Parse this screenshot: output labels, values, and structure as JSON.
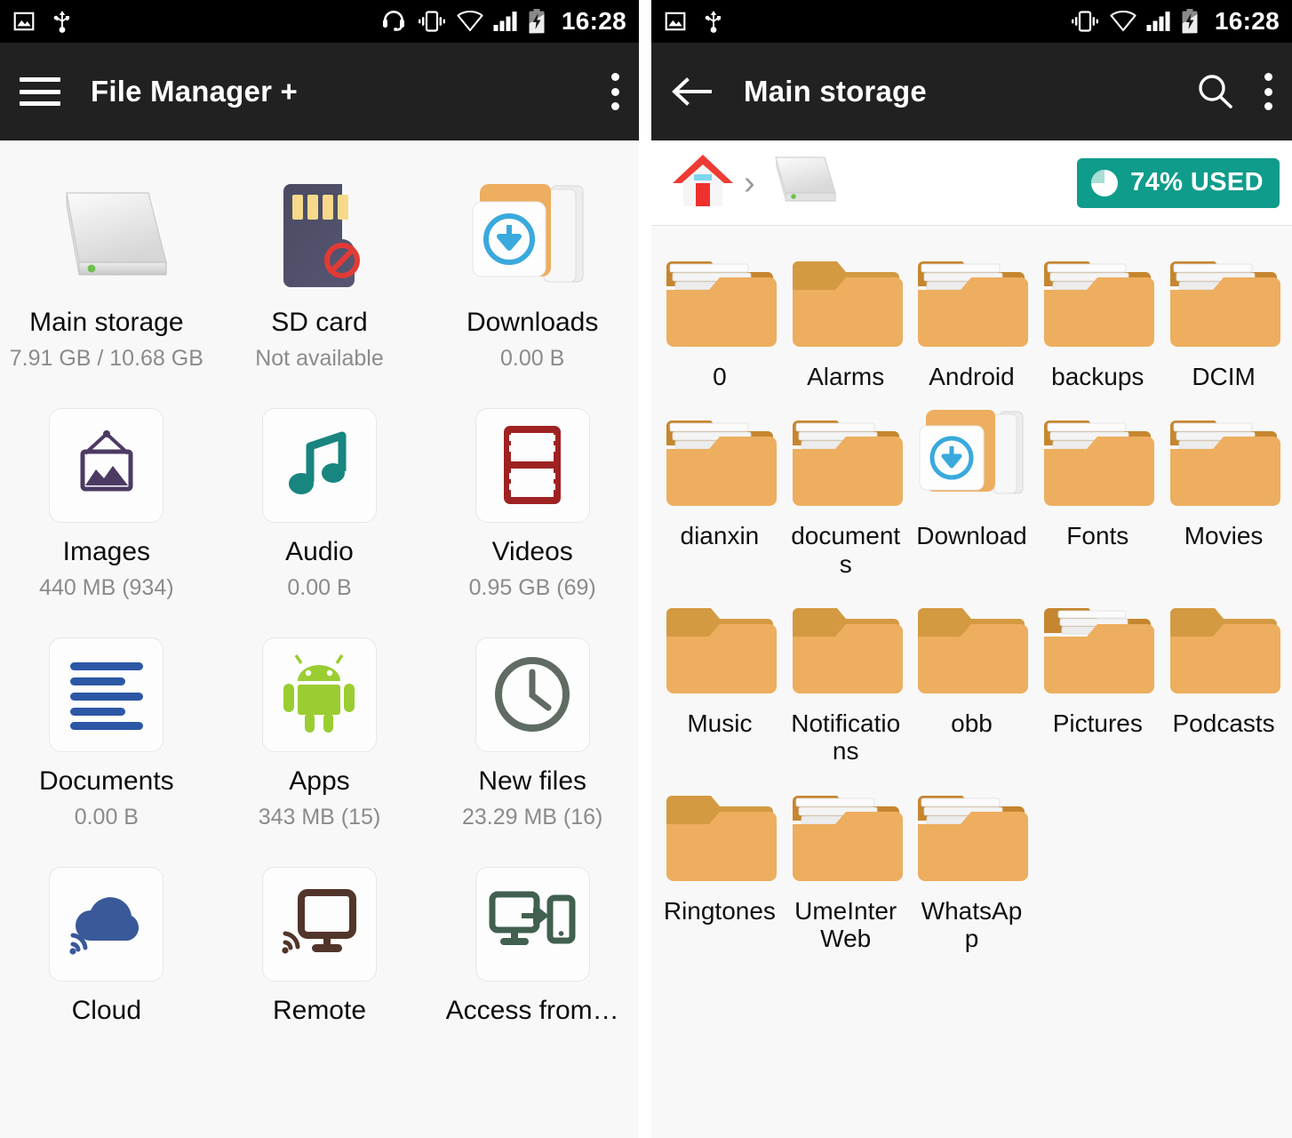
{
  "status_bar": {
    "time": "16:28",
    "left_icons": [
      "image-icon",
      "usb-icon"
    ],
    "right_icons_left_phone": [
      "headset-icon",
      "vibrate-icon",
      "wifi-icon",
      "signal-icon",
      "battery-charging-icon"
    ],
    "right_icons_right_phone": [
      "vibrate-icon",
      "wifi-icon",
      "signal-icon",
      "battery-charging-icon"
    ]
  },
  "colors": {
    "status_bar_bg": "#000000",
    "toolbar_bg": "#212121",
    "page_bg": "#f8f8f9",
    "badge_teal": "#0f9c8b",
    "folder_orange": "#edae5f",
    "folder_tab": "#c6862f",
    "accent_blue": "#3aa9dd"
  },
  "left_screen": {
    "toolbar": {
      "title": "File Manager +",
      "menu_label": "menu",
      "overflow_label": "more options"
    },
    "items": [
      {
        "label": "Main storage",
        "sub": "7.91 GB / 10.68 GB",
        "icon": "hard-drive-icon"
      },
      {
        "label": "SD card",
        "sub": "Not available",
        "icon": "sd-card-unavailable-icon"
      },
      {
        "label": "Downloads",
        "sub": "0.00 B",
        "icon": "download-folder-icon"
      },
      {
        "label": "Images",
        "sub": "440 MB (934)",
        "icon": "picture-icon"
      },
      {
        "label": "Audio",
        "sub": "0.00 B",
        "icon": "music-note-icon"
      },
      {
        "label": "Videos",
        "sub": "0.95 GB (69)",
        "icon": "film-strip-icon"
      },
      {
        "label": "Documents",
        "sub": "0.00 B",
        "icon": "document-lines-icon"
      },
      {
        "label": "Apps",
        "sub": "343 MB (15)",
        "icon": "android-robot-icon"
      },
      {
        "label": "New files",
        "sub": "23.29 MB (16)",
        "icon": "clock-icon"
      },
      {
        "label": "Cloud",
        "sub": "",
        "icon": "cloud-wifi-icon"
      },
      {
        "label": "Remote",
        "sub": "",
        "icon": "monitor-wifi-icon"
      },
      {
        "label": "Access from…",
        "sub": "",
        "icon": "pc-to-phone-icon"
      }
    ]
  },
  "right_screen": {
    "toolbar": {
      "title": "Main storage",
      "back_label": "back",
      "search_label": "search",
      "overflow_label": "more options"
    },
    "breadcrumb": {
      "items": [
        "home-icon",
        "hard-drive-icon"
      ],
      "separator": "›",
      "storage_badge": "74% USED",
      "used_percent": 74
    },
    "folders": [
      {
        "name": "0",
        "has_files": true
      },
      {
        "name": "Alarms",
        "has_files": false
      },
      {
        "name": "Android",
        "has_files": true
      },
      {
        "name": "backups",
        "has_files": true
      },
      {
        "name": "DCIM",
        "has_files": true
      },
      {
        "name": "dianxin",
        "has_files": true
      },
      {
        "name": "documents",
        "has_files": true
      },
      {
        "name": "Download",
        "has_files": true,
        "special": "download-folder-icon"
      },
      {
        "name": "Fonts",
        "has_files": true
      },
      {
        "name": "Movies",
        "has_files": true
      },
      {
        "name": "Music",
        "has_files": false
      },
      {
        "name": "Notifications",
        "has_files": false
      },
      {
        "name": "obb",
        "has_files": false
      },
      {
        "name": "Pictures",
        "has_files": true
      },
      {
        "name": "Podcasts",
        "has_files": false
      },
      {
        "name": "Ringtones",
        "has_files": false
      },
      {
        "name": "UmeInterWeb",
        "has_files": true
      },
      {
        "name": "WhatsApp",
        "has_files": true
      }
    ]
  }
}
